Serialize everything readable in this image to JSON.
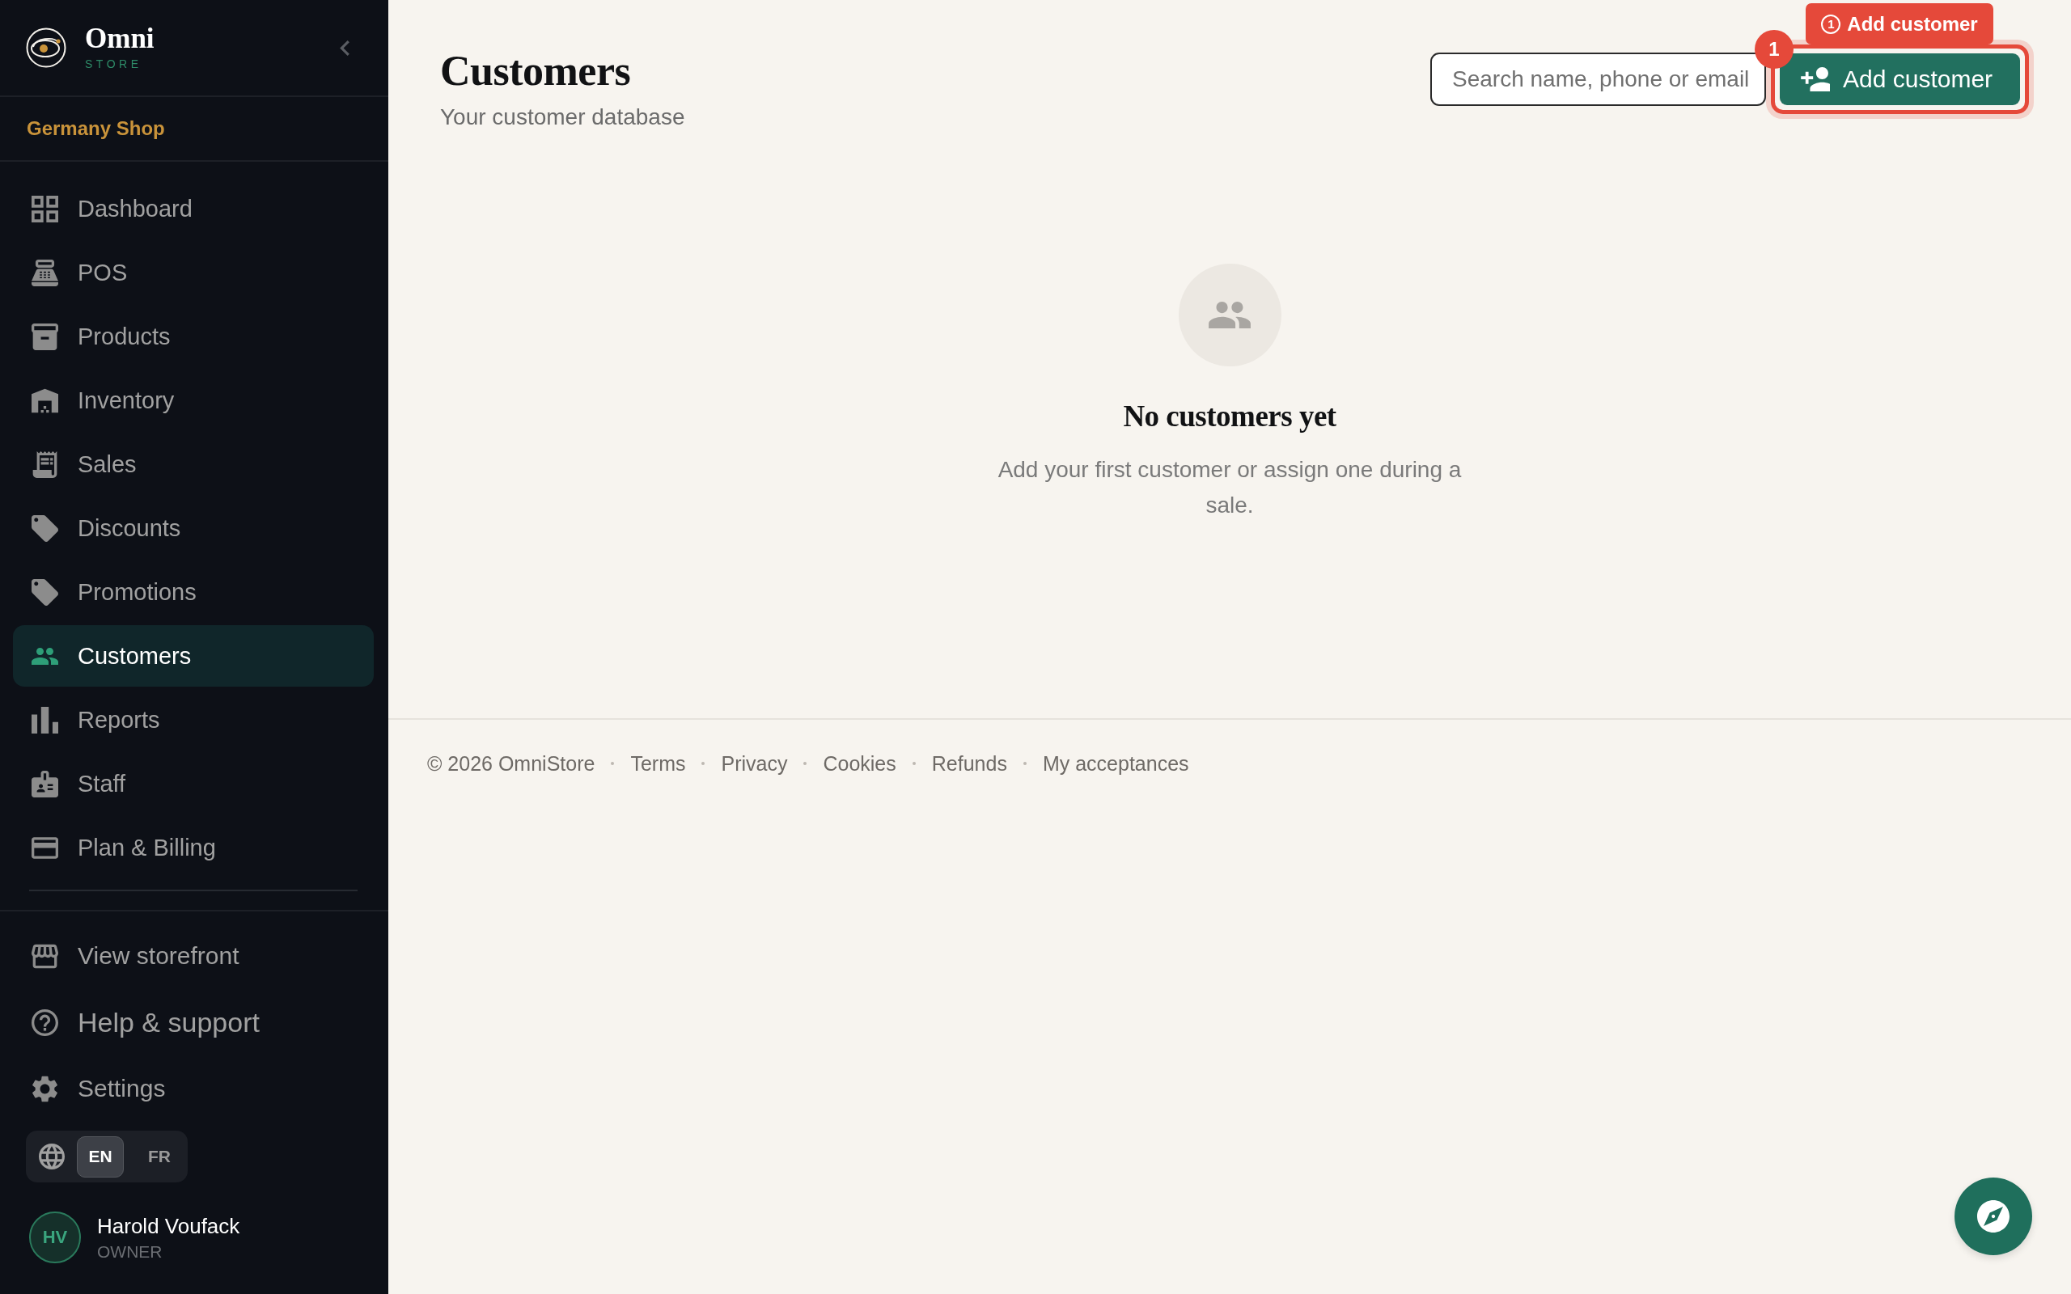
{
  "sidebar": {
    "brand": {
      "name": "Omni",
      "tagline": "STORE"
    },
    "shop": "Germany Shop",
    "nav": [
      {
        "label": "Dashboard",
        "selected": false
      },
      {
        "label": "POS",
        "selected": false
      },
      {
        "label": "Products",
        "selected": false
      },
      {
        "label": "Inventory",
        "selected": false
      },
      {
        "label": "Sales",
        "selected": false
      },
      {
        "label": "Discounts",
        "selected": false
      },
      {
        "label": "Promotions",
        "selected": false
      },
      {
        "label": "Customers",
        "selected": true
      },
      {
        "label": "Reports",
        "selected": false
      },
      {
        "label": "Staff",
        "selected": false
      },
      {
        "label": "Plan & Billing",
        "selected": false
      }
    ],
    "links": [
      {
        "label": "View storefront"
      },
      {
        "label": "Help & support"
      },
      {
        "label": "Settings"
      }
    ],
    "languages": [
      {
        "label": "EN",
        "selected": true
      },
      {
        "label": "FR",
        "selected": false
      }
    ],
    "user": {
      "initials": "HV",
      "name": "Harold Voufack",
      "role": "OWNER"
    }
  },
  "page": {
    "title": "Customers",
    "subtitle": "Your customer database"
  },
  "search": {
    "placeholder": "Search name, phone or email"
  },
  "add_button": {
    "label": "Add customer"
  },
  "tour": {
    "badge": "1",
    "tag_step": "1",
    "tag_label": "Add customer"
  },
  "empty_state": {
    "title": "No customers yet",
    "message": "Add your first customer or assign one during a sale."
  },
  "footer": {
    "copyright": "© 2026 OmniStore",
    "links": [
      "Terms",
      "Privacy",
      "Cookies",
      "Refunds",
      "My acceptances"
    ]
  }
}
